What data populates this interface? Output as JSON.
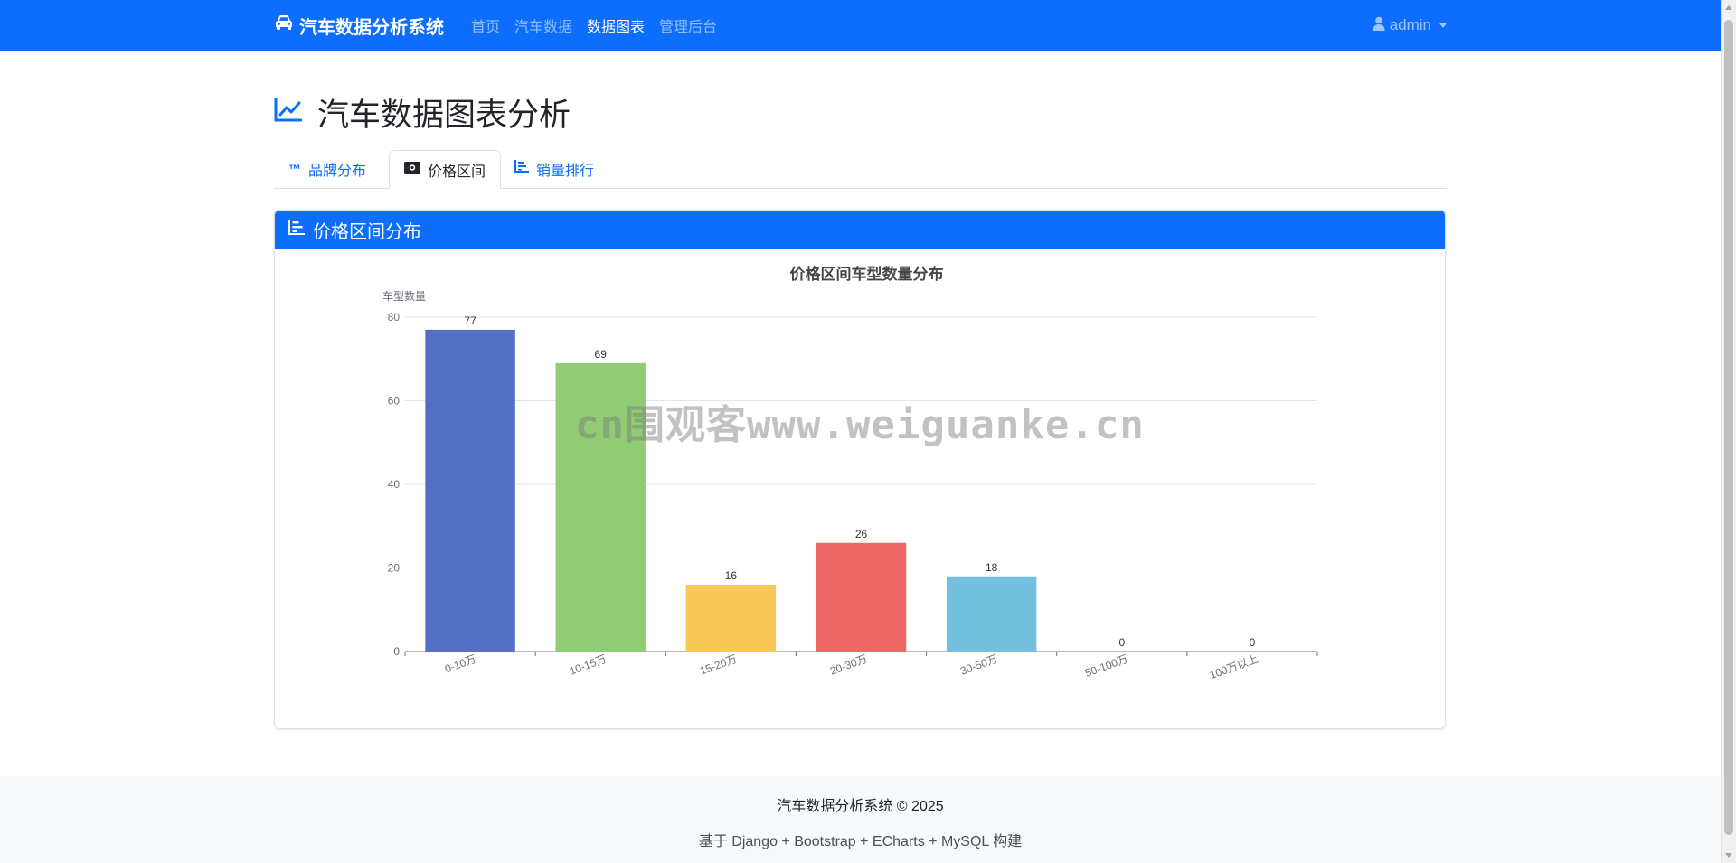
{
  "navbar": {
    "brand": "汽车数据分析系统",
    "brand_icon": "car-icon",
    "links": [
      "首页",
      "汽车数据",
      "数据图表",
      "管理后台"
    ],
    "active_link": "数据图表",
    "user": "admin",
    "user_icon": "user-icon"
  },
  "page": {
    "title": "汽车数据图表分析",
    "title_icon": "chart-line-icon"
  },
  "tabs": [
    {
      "label": "品牌分布",
      "icon": "trademark-icon"
    },
    {
      "label": "价格区间",
      "icon": "money-bill-icon"
    },
    {
      "label": "销量排行",
      "icon": "chart-bar-icon"
    }
  ],
  "active_tab": "价格区间",
  "card": {
    "header": "价格区间分布",
    "header_icon": "chart-bar-icon"
  },
  "chart_data": {
    "type": "bar",
    "title": "价格区间车型数量分布",
    "ylabel": "车型数量",
    "xlabel": "",
    "categories": [
      "0-10万",
      "10-15万",
      "15-20万",
      "20-30万",
      "30-50万",
      "50-100万",
      "100万以上"
    ],
    "values": [
      77,
      69,
      16,
      26,
      18,
      0,
      0
    ],
    "colors": [
      "#5470c6",
      "#91cc75",
      "#fac858",
      "#ee6666",
      "#73c0de",
      "#3ba272",
      "#fc8452"
    ],
    "ylim": [
      0,
      80
    ],
    "yticks": [
      0,
      20,
      40,
      60,
      80
    ],
    "grid": true,
    "data_labels": true
  },
  "watermark": "cn围观客www.weiguanke.cn",
  "footer": {
    "line1": "汽车数据分析系统 © 2025",
    "line2": "基于 Django + Bootstrap + ECharts + MySQL 构建"
  },
  "theme": {
    "primary": "#0d6efd"
  }
}
